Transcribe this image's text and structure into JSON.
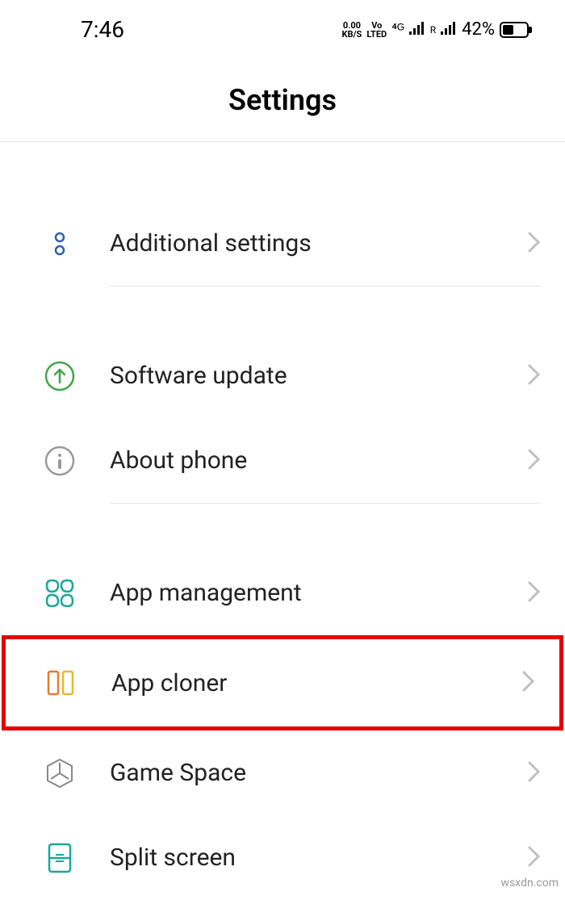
{
  "statusBar": {
    "time": "7:46",
    "dataSpeed": "0.00",
    "dataSpeedUnit": "KB/S",
    "volte": "Vo",
    "lted": "LTED",
    "network4g": "4G",
    "roaming": "R",
    "batteryPercent": "42%"
  },
  "header": {
    "title": "Settings"
  },
  "items": {
    "additionalSettings": "Additional settings",
    "softwareUpdate": "Software update",
    "aboutPhone": "About phone",
    "appManagement": "App management",
    "appCloner": "App cloner",
    "gameSpace": "Game Space",
    "splitScreen": "Split screen"
  },
  "watermark": "wsxdn.com"
}
